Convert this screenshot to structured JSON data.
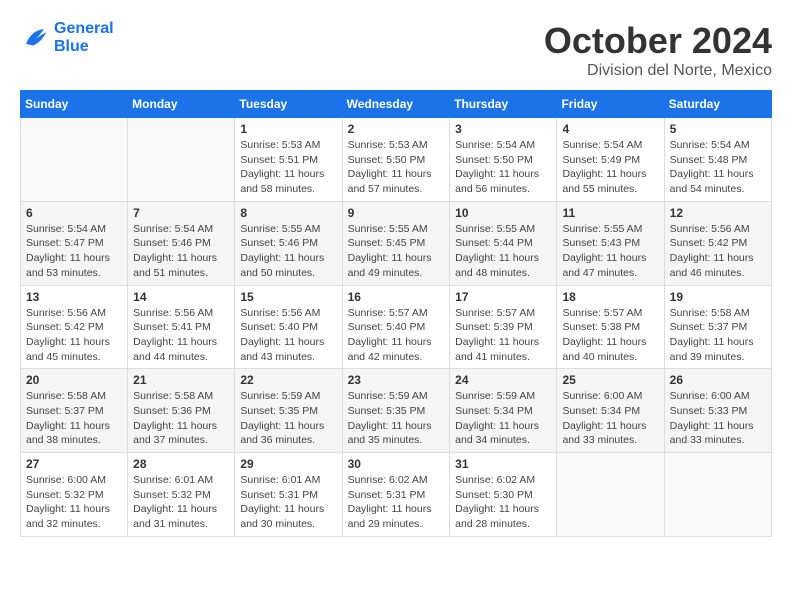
{
  "logo": {
    "line1": "General",
    "line2": "Blue"
  },
  "title": "October 2024",
  "subtitle": "Division del Norte, Mexico",
  "days_of_week": [
    "Sunday",
    "Monday",
    "Tuesday",
    "Wednesday",
    "Thursday",
    "Friday",
    "Saturday"
  ],
  "weeks": [
    [
      {
        "day": "",
        "info": ""
      },
      {
        "day": "",
        "info": ""
      },
      {
        "day": "1",
        "sunrise": "Sunrise: 5:53 AM",
        "sunset": "Sunset: 5:51 PM",
        "daylight": "Daylight: 11 hours and 58 minutes."
      },
      {
        "day": "2",
        "sunrise": "Sunrise: 5:53 AM",
        "sunset": "Sunset: 5:50 PM",
        "daylight": "Daylight: 11 hours and 57 minutes."
      },
      {
        "day": "3",
        "sunrise": "Sunrise: 5:54 AM",
        "sunset": "Sunset: 5:50 PM",
        "daylight": "Daylight: 11 hours and 56 minutes."
      },
      {
        "day": "4",
        "sunrise": "Sunrise: 5:54 AM",
        "sunset": "Sunset: 5:49 PM",
        "daylight": "Daylight: 11 hours and 55 minutes."
      },
      {
        "day": "5",
        "sunrise": "Sunrise: 5:54 AM",
        "sunset": "Sunset: 5:48 PM",
        "daylight": "Daylight: 11 hours and 54 minutes."
      }
    ],
    [
      {
        "day": "6",
        "sunrise": "Sunrise: 5:54 AM",
        "sunset": "Sunset: 5:47 PM",
        "daylight": "Daylight: 11 hours and 53 minutes."
      },
      {
        "day": "7",
        "sunrise": "Sunrise: 5:54 AM",
        "sunset": "Sunset: 5:46 PM",
        "daylight": "Daylight: 11 hours and 51 minutes."
      },
      {
        "day": "8",
        "sunrise": "Sunrise: 5:55 AM",
        "sunset": "Sunset: 5:46 PM",
        "daylight": "Daylight: 11 hours and 50 minutes."
      },
      {
        "day": "9",
        "sunrise": "Sunrise: 5:55 AM",
        "sunset": "Sunset: 5:45 PM",
        "daylight": "Daylight: 11 hours and 49 minutes."
      },
      {
        "day": "10",
        "sunrise": "Sunrise: 5:55 AM",
        "sunset": "Sunset: 5:44 PM",
        "daylight": "Daylight: 11 hours and 48 minutes."
      },
      {
        "day": "11",
        "sunrise": "Sunrise: 5:55 AM",
        "sunset": "Sunset: 5:43 PM",
        "daylight": "Daylight: 11 hours and 47 minutes."
      },
      {
        "day": "12",
        "sunrise": "Sunrise: 5:56 AM",
        "sunset": "Sunset: 5:42 PM",
        "daylight": "Daylight: 11 hours and 46 minutes."
      }
    ],
    [
      {
        "day": "13",
        "sunrise": "Sunrise: 5:56 AM",
        "sunset": "Sunset: 5:42 PM",
        "daylight": "Daylight: 11 hours and 45 minutes."
      },
      {
        "day": "14",
        "sunrise": "Sunrise: 5:56 AM",
        "sunset": "Sunset: 5:41 PM",
        "daylight": "Daylight: 11 hours and 44 minutes."
      },
      {
        "day": "15",
        "sunrise": "Sunrise: 5:56 AM",
        "sunset": "Sunset: 5:40 PM",
        "daylight": "Daylight: 11 hours and 43 minutes."
      },
      {
        "day": "16",
        "sunrise": "Sunrise: 5:57 AM",
        "sunset": "Sunset: 5:40 PM",
        "daylight": "Daylight: 11 hours and 42 minutes."
      },
      {
        "day": "17",
        "sunrise": "Sunrise: 5:57 AM",
        "sunset": "Sunset: 5:39 PM",
        "daylight": "Daylight: 11 hours and 41 minutes."
      },
      {
        "day": "18",
        "sunrise": "Sunrise: 5:57 AM",
        "sunset": "Sunset: 5:38 PM",
        "daylight": "Daylight: 11 hours and 40 minutes."
      },
      {
        "day": "19",
        "sunrise": "Sunrise: 5:58 AM",
        "sunset": "Sunset: 5:37 PM",
        "daylight": "Daylight: 11 hours and 39 minutes."
      }
    ],
    [
      {
        "day": "20",
        "sunrise": "Sunrise: 5:58 AM",
        "sunset": "Sunset: 5:37 PM",
        "daylight": "Daylight: 11 hours and 38 minutes."
      },
      {
        "day": "21",
        "sunrise": "Sunrise: 5:58 AM",
        "sunset": "Sunset: 5:36 PM",
        "daylight": "Daylight: 11 hours and 37 minutes."
      },
      {
        "day": "22",
        "sunrise": "Sunrise: 5:59 AM",
        "sunset": "Sunset: 5:35 PM",
        "daylight": "Daylight: 11 hours and 36 minutes."
      },
      {
        "day": "23",
        "sunrise": "Sunrise: 5:59 AM",
        "sunset": "Sunset: 5:35 PM",
        "daylight": "Daylight: 11 hours and 35 minutes."
      },
      {
        "day": "24",
        "sunrise": "Sunrise: 5:59 AM",
        "sunset": "Sunset: 5:34 PM",
        "daylight": "Daylight: 11 hours and 34 minutes."
      },
      {
        "day": "25",
        "sunrise": "Sunrise: 6:00 AM",
        "sunset": "Sunset: 5:34 PM",
        "daylight": "Daylight: 11 hours and 33 minutes."
      },
      {
        "day": "26",
        "sunrise": "Sunrise: 6:00 AM",
        "sunset": "Sunset: 5:33 PM",
        "daylight": "Daylight: 11 hours and 33 minutes."
      }
    ],
    [
      {
        "day": "27",
        "sunrise": "Sunrise: 6:00 AM",
        "sunset": "Sunset: 5:32 PM",
        "daylight": "Daylight: 11 hours and 32 minutes."
      },
      {
        "day": "28",
        "sunrise": "Sunrise: 6:01 AM",
        "sunset": "Sunset: 5:32 PM",
        "daylight": "Daylight: 11 hours and 31 minutes."
      },
      {
        "day": "29",
        "sunrise": "Sunrise: 6:01 AM",
        "sunset": "Sunset: 5:31 PM",
        "daylight": "Daylight: 11 hours and 30 minutes."
      },
      {
        "day": "30",
        "sunrise": "Sunrise: 6:02 AM",
        "sunset": "Sunset: 5:31 PM",
        "daylight": "Daylight: 11 hours and 29 minutes."
      },
      {
        "day": "31",
        "sunrise": "Sunrise: 6:02 AM",
        "sunset": "Sunset: 5:30 PM",
        "daylight": "Daylight: 11 hours and 28 minutes."
      },
      {
        "day": "",
        "info": ""
      },
      {
        "day": "",
        "info": ""
      }
    ]
  ]
}
